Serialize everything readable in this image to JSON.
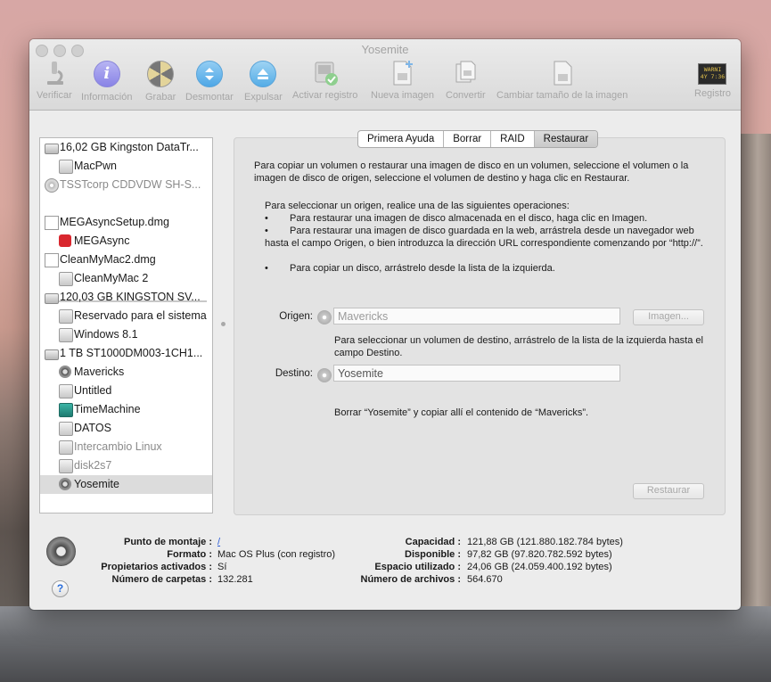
{
  "window": {
    "title": "Yosemite"
  },
  "toolbar": {
    "items": [
      {
        "label": "Verificar",
        "icon": "microscope-icon"
      },
      {
        "label": "Información",
        "icon": "info-icon"
      },
      {
        "label": "Grabar",
        "icon": "burn-icon"
      },
      {
        "label": "Desmontar",
        "icon": "unmount-icon"
      },
      {
        "label": "Expulsar",
        "icon": "eject-icon"
      },
      {
        "label": "Activar registro",
        "icon": "enable-journaling-icon"
      },
      {
        "label": "Nueva imagen",
        "icon": "new-image-icon"
      },
      {
        "label": "Convertir",
        "icon": "convert-icon"
      },
      {
        "label": "Cambiar tamaño de la imagen",
        "icon": "resize-image-icon"
      },
      {
        "label": "Registro",
        "icon": "log-icon"
      }
    ],
    "log_icon_text": [
      "WARNI",
      "4Y 7:36"
    ]
  },
  "sidebar": {
    "items": [
      {
        "label": "16,02 GB Kingston DataTr...",
        "type": "disk"
      },
      {
        "label": "MacPwn",
        "type": "volume"
      },
      {
        "label": "TSSTcorp CDDVDW SH-S...",
        "type": "cd"
      },
      {
        "label": "MEGAsyncSetup.dmg",
        "type": "dmg"
      },
      {
        "label": "MEGAsync",
        "type": "mega"
      },
      {
        "label": "CleanMyMac2.dmg",
        "type": "dmg"
      },
      {
        "label": "CleanMyMac 2",
        "type": "volume"
      },
      {
        "label": "120,03 GB KINGSTON SV...",
        "type": "disk"
      },
      {
        "label": "Reservado para el sistema",
        "type": "volume"
      },
      {
        "label": "Windows 8.1",
        "type": "volume"
      },
      {
        "label": "1 TB ST1000DM003-1CH1...",
        "type": "disk"
      },
      {
        "label": "Mavericks",
        "type": "osx"
      },
      {
        "label": "Untitled",
        "type": "volume"
      },
      {
        "label": "TimeMachine",
        "type": "timemachine"
      },
      {
        "label": "DATOS",
        "type": "volume"
      },
      {
        "label": "Intercambio Linux",
        "type": "volume"
      },
      {
        "label": "disk2s7",
        "type": "volume"
      },
      {
        "label": "Yosemite",
        "type": "osx"
      }
    ]
  },
  "tabs": [
    {
      "label": "Primera Ayuda"
    },
    {
      "label": "Borrar"
    },
    {
      "label": "RAID"
    },
    {
      "label": "Restaurar"
    }
  ],
  "restore": {
    "intro": "Para copiar un volumen o restaurar una imagen de disco en un volumen, seleccione el volumen o la imagen de disco de origen, seleccione el volumen de destino y haga clic en Restaurar.",
    "howto_title": "Para seleccionar un origen, realice una de las siguientes operaciones:",
    "bullet": "•",
    "bullets": [
      "Para restaurar una imagen de disco almacenada en el disco, haga clic en Imagen.",
      "Para restaurar una imagen de disco guardada en la web, arrástrela desde un navegador web hasta el campo Origen, o bien introduzca la dirección URL correspondiente comenzando por “http://”.",
      "Para copiar un disco, arrástrelo desde la lista de la izquierda."
    ],
    "source_label": "Origen:",
    "source_value": "Mavericks",
    "image_button": "Imagen...",
    "dest_hint": "Para seleccionar un volumen de destino, arrástrelo de la lista de la izquierda hasta el campo Destino.",
    "dest_label": "Destino:",
    "dest_value": "Yosemite",
    "summary": "Borrar “Yosemite” y copiar allí el contenido de “Mavericks”.",
    "restore_button": "Restaurar"
  },
  "info": {
    "left": [
      {
        "key": "Punto de montaje :",
        "value": "/"
      },
      {
        "key": "Formato :",
        "value": "Mac OS Plus (con registro)"
      },
      {
        "key": "Propietarios activados :",
        "value": "Sí"
      },
      {
        "key": "Número de carpetas :",
        "value": "132.281"
      }
    ],
    "right": [
      {
        "key": "Capacidad :",
        "value": "121,88 GB (121.880.182.784 bytes)"
      },
      {
        "key": "Disponible :",
        "value": "97,82 GB (97.820.782.592 bytes)"
      },
      {
        "key": "Espacio utilizado :",
        "value": "24,06 GB (24.059.400.192 bytes)"
      },
      {
        "key": "Número de archivos :",
        "value": "564.670"
      }
    ],
    "help": "?"
  }
}
